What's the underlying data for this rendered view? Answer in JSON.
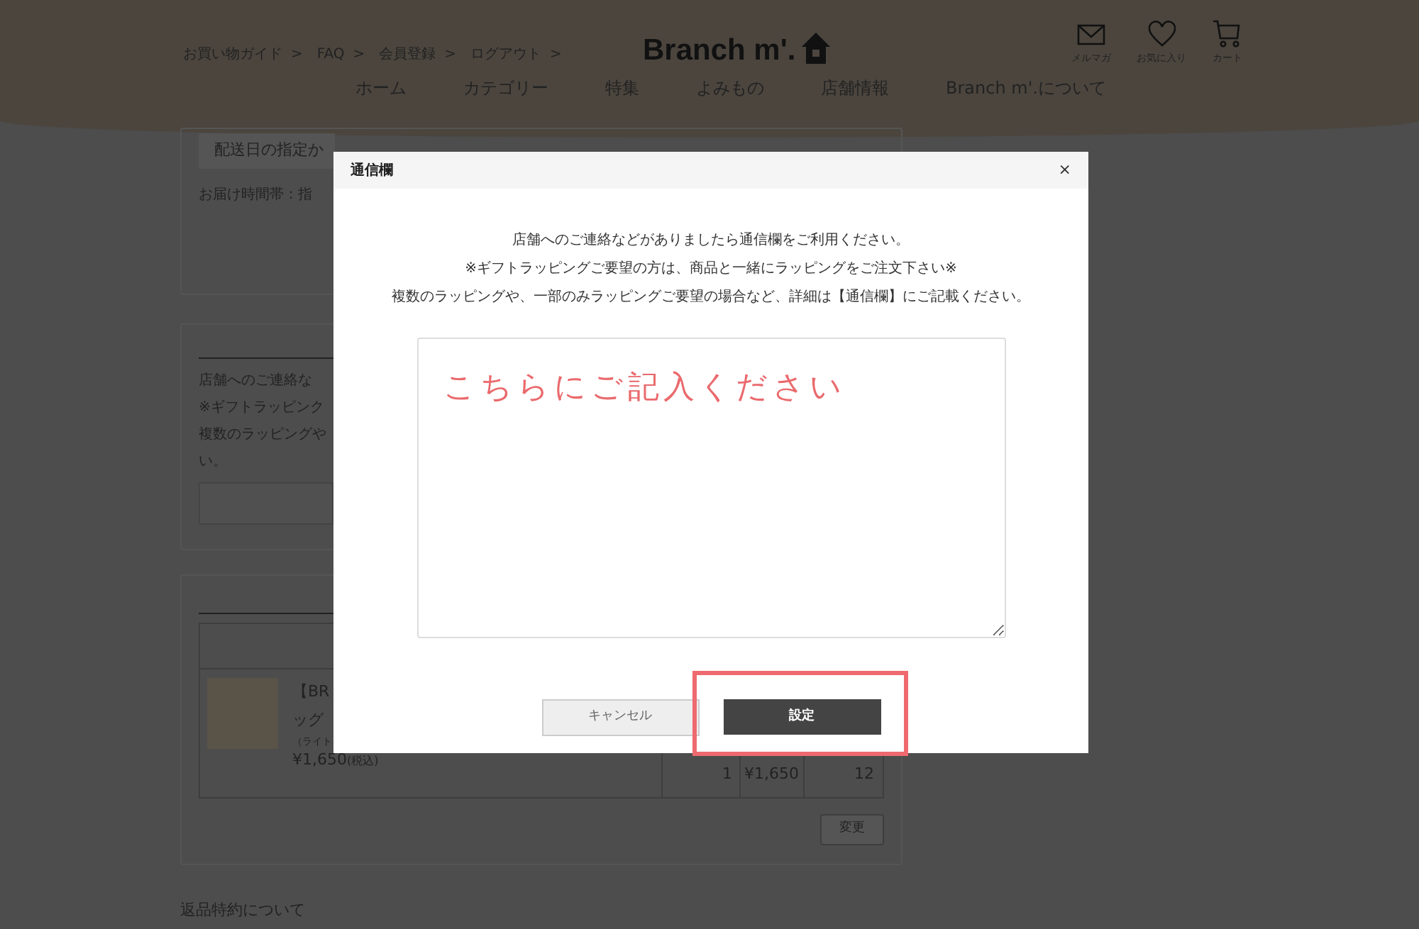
{
  "header": {
    "breadcrumbs": [
      "お買い物ガイド",
      "FAQ",
      "会員登録",
      "ログアウト"
    ],
    "separator": ">",
    "logo": "Branch m'.",
    "icons": [
      {
        "kind": "mail",
        "label": "メルマガ"
      },
      {
        "kind": "heart",
        "label": "お気に入り"
      },
      {
        "kind": "cart",
        "label": "カート"
      }
    ],
    "nav": [
      "ホーム",
      "カテゴリー",
      "特集",
      "よみもの",
      "店舗情報",
      "Branch m'.について"
    ]
  },
  "delivery": {
    "date_field": "配送日の指定か",
    "time_label": "お届け時間帯：指"
  },
  "message_section": {
    "lines": [
      "店舗へのご連絡な",
      "※ギフトラッピンク",
      "複数のラッピングや",
      "い。"
    ]
  },
  "items": {
    "rows": [
      {
        "name_lines": [
          "【BR",
          "ッグ"
        ],
        "variant": "（ライト",
        "price": "¥1,650",
        "tax": "(税込)",
        "quantity": "1",
        "subtotal": "¥1,650",
        "points": "12"
      }
    ],
    "change_button": "変更"
  },
  "returns_link": "返品特約について",
  "modal": {
    "title": "通信欄",
    "close": "×",
    "lines": [
      "店舗へのご連絡などがありましたら通信欄をご利用ください。",
      "※ギフトラッピングご要望の方は、商品と一緒にラッピングをご注文下さい※",
      "複数のラッピングや、一部のみラッピングご要望の場合など、詳細は【通信欄】にご記載ください。"
    ],
    "placeholder": "こちらにご記入ください",
    "buttons": [
      {
        "kind": "secondary",
        "label": "キャンセル"
      },
      {
        "kind": "primary",
        "label": "設定",
        "highlighted": true
      }
    ]
  }
}
